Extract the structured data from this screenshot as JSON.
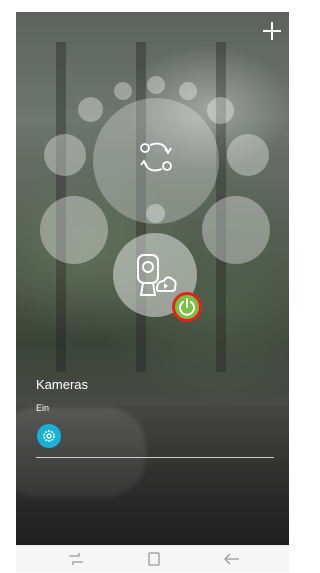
{
  "device": {
    "name": "Kameras",
    "state": "Ein"
  },
  "icons": {
    "add": "plus-icon",
    "scene": "sync-arrows-icon",
    "device": "camera-cloud-icon",
    "power": "power-icon",
    "settings": "gear-icon",
    "nav_recent": "recent-apps-icon",
    "nav_home": "home-icon",
    "nav_back": "back-icon"
  },
  "colors": {
    "power_fill": "#7bc043",
    "power_ring": "#e2231a",
    "settings_fill": "#19b2d6"
  }
}
